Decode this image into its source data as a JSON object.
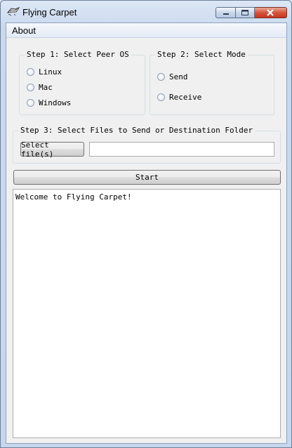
{
  "window": {
    "title": "Flying Carpet"
  },
  "menu": {
    "items": [
      {
        "label": "About"
      }
    ]
  },
  "step1": {
    "title": "Step 1: Select Peer OS",
    "options": [
      "Linux",
      "Mac",
      "Windows"
    ]
  },
  "step2": {
    "title": "Step 2: Select Mode",
    "options": [
      "Send",
      "Receive"
    ]
  },
  "step3": {
    "title": "Step 3: Select Files to Send or Destination Folder",
    "select_button": "Select file(s)",
    "path_value": ""
  },
  "start_button": "Start",
  "log": {
    "text": "Welcome to Flying Carpet!"
  },
  "colors": {
    "close_button": "#c5351f",
    "frame": "#c6d6ec",
    "client_bg": "#f0f0f0"
  }
}
